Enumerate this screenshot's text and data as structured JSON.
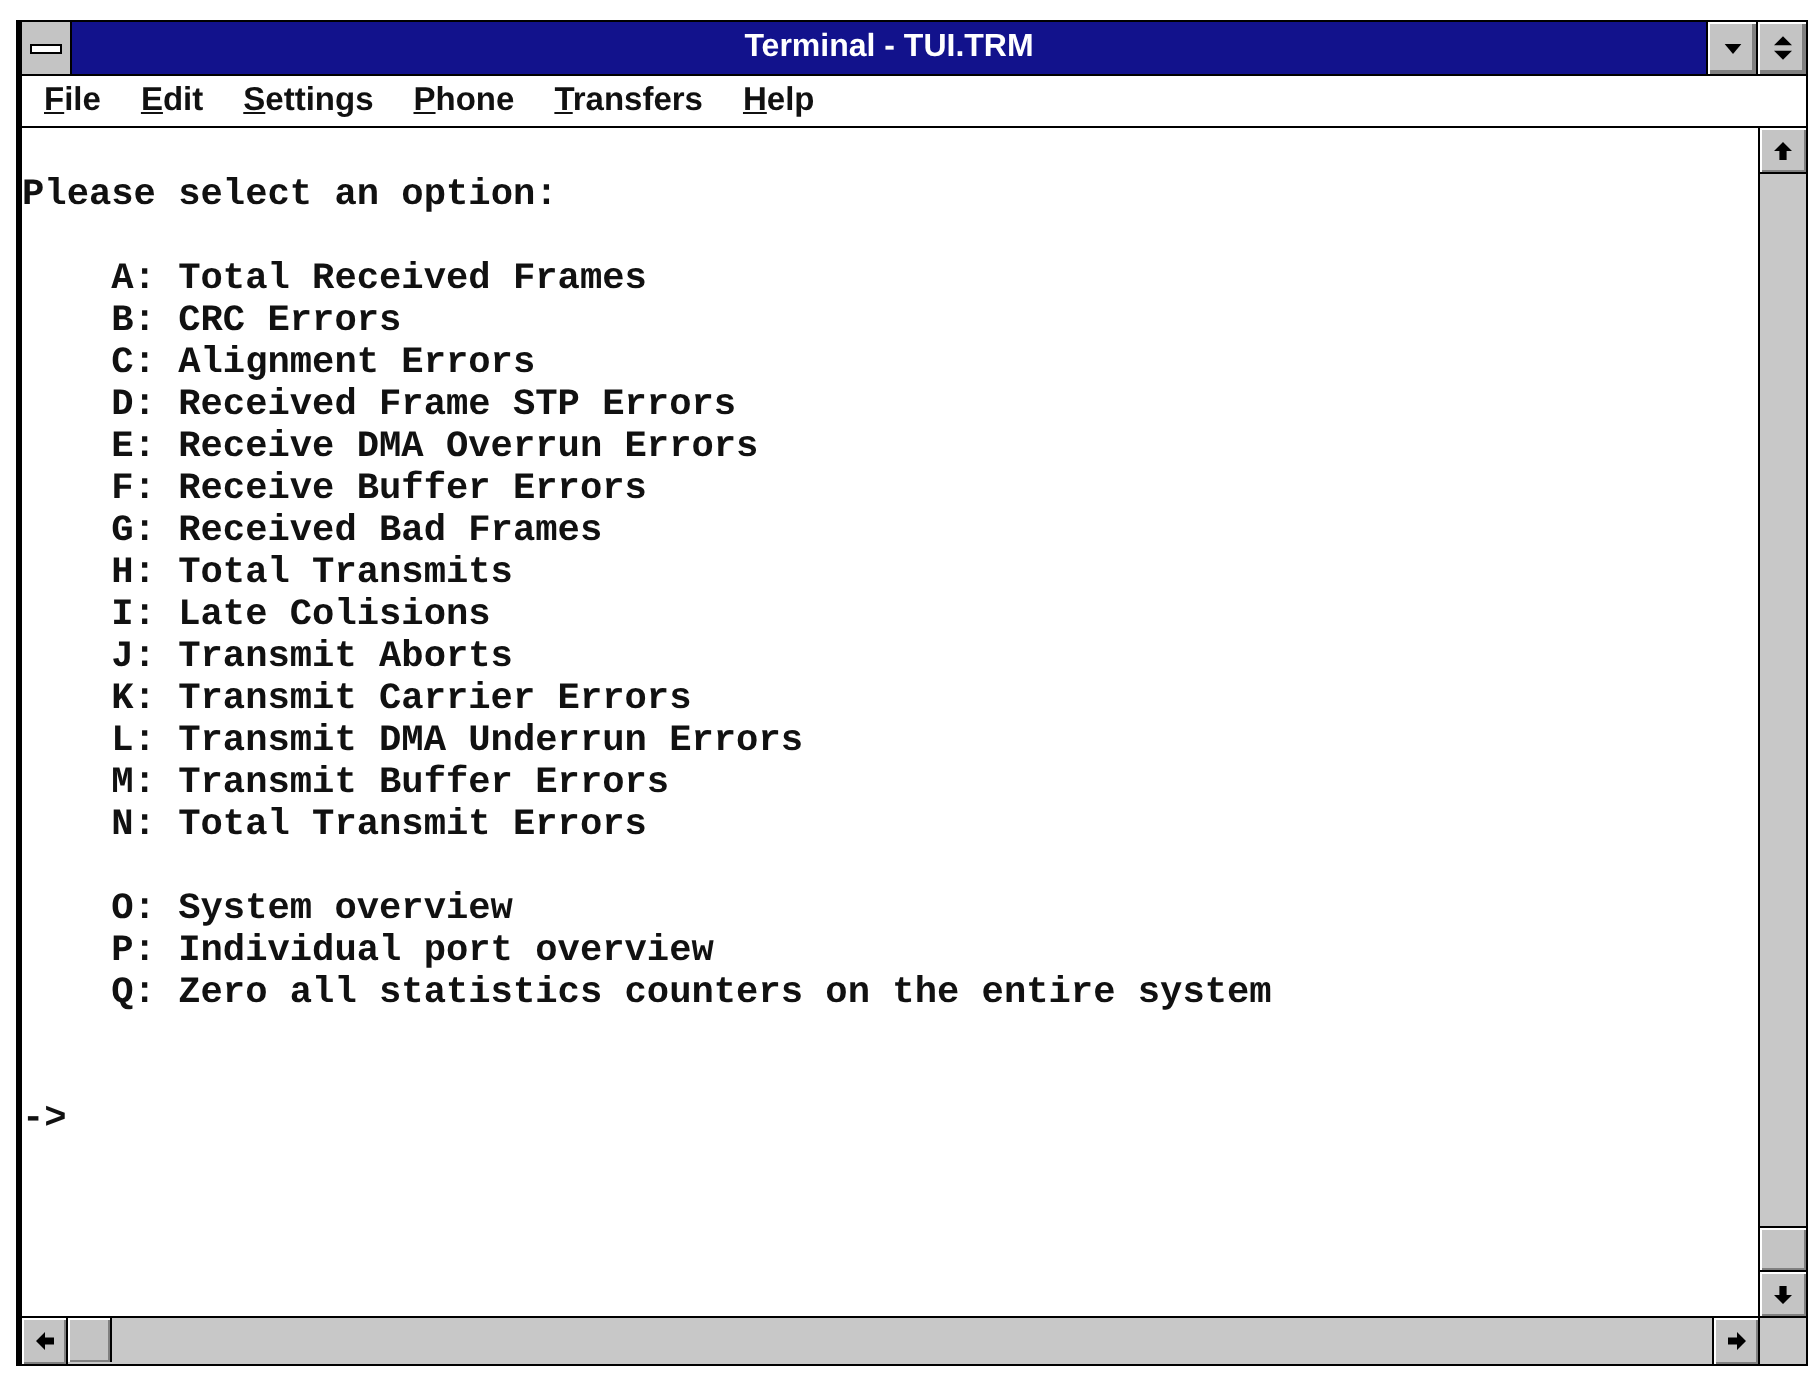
{
  "window": {
    "title": "Terminal - TUI.TRM"
  },
  "menu": [
    {
      "mnemonic": "F",
      "rest": "ile"
    },
    {
      "mnemonic": "E",
      "rest": "dit"
    },
    {
      "mnemonic": "S",
      "rest": "ettings"
    },
    {
      "mnemonic": "P",
      "rest": "hone"
    },
    {
      "mnemonic": "T",
      "rest": "ransfers"
    },
    {
      "mnemonic": "H",
      "rest": "elp"
    }
  ],
  "terminal": {
    "heading": "Please select an option:",
    "option_groups": [
      {
        "options": [
          "A: Total Received Frames",
          "B: CRC Errors",
          "C: Alignment Errors",
          "D: Received Frame STP Errors",
          "E: Receive DMA Overrun Errors",
          "F: Receive Buffer Errors",
          "G: Received Bad Frames",
          "H: Total Transmits",
          "I: Late Colisions",
          "J: Transmit Aborts",
          "K: Transmit Carrier Errors",
          "L: Transmit DMA Underrun Errors",
          "M: Transmit Buffer Errors",
          "N: Total Transmit Errors"
        ]
      },
      {
        "options": [
          "O: System overview",
          "P: Individual port overview",
          "Q: Zero all statistics counters on the entire system"
        ]
      }
    ],
    "input_prompt": "->"
  }
}
